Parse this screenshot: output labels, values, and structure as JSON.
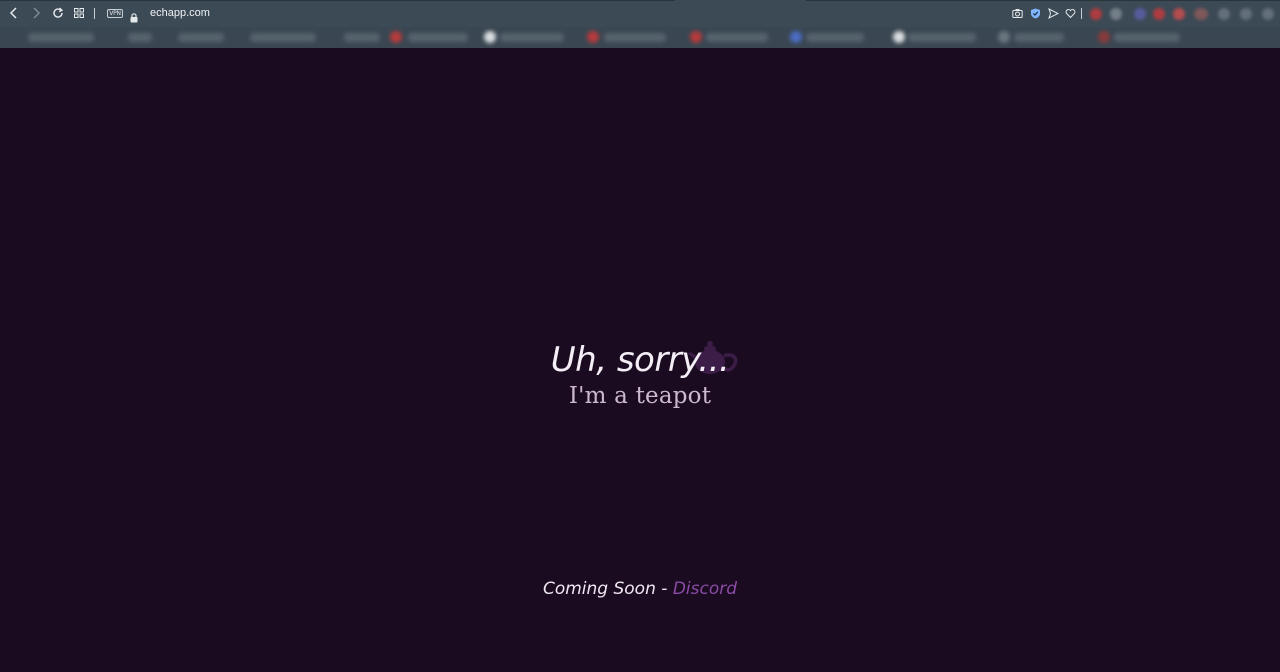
{
  "browser": {
    "url": "echapp.com",
    "vpn_label": "VPN",
    "nav_icons": [
      "back-icon",
      "forward-icon",
      "reload-icon",
      "tabs-grid-icon"
    ],
    "toolbar_icons": [
      "camera-icon",
      "shield-icon",
      "send-icon",
      "heart-icon"
    ]
  },
  "content": {
    "headline": "Uh, sorry...",
    "subheadline": "I'm a teapot",
    "footer_text": "Coming Soon - ",
    "footer_link": "Discord",
    "illustration_icon": "teapot-icon"
  },
  "colors": {
    "page_background": "#1a0b20",
    "chrome_background": "#3c4a56",
    "headline": "#f4eef6",
    "subheadline": "#cbb9d1",
    "link": "#8a4aa6",
    "teapot": "#3b1d48"
  }
}
